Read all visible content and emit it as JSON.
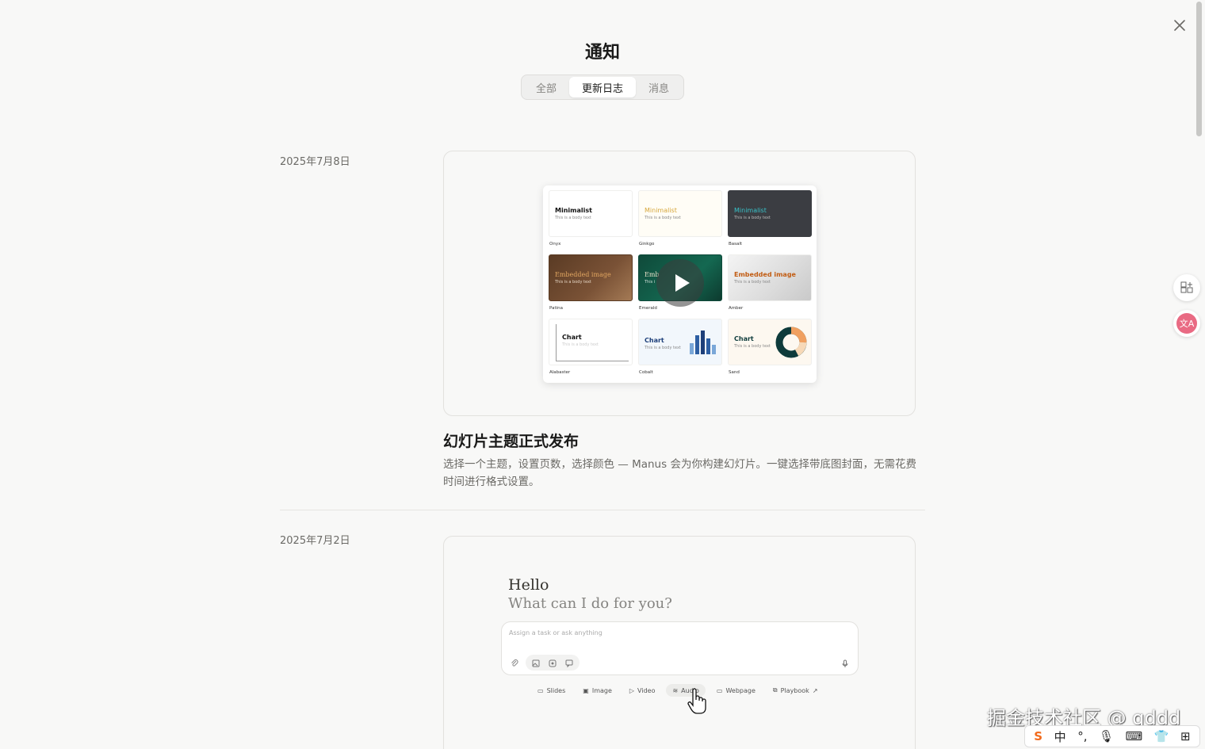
{
  "header": {
    "title": "通知",
    "tabs": [
      {
        "label": "全部",
        "active": false
      },
      {
        "label": "更新日志",
        "active": true
      },
      {
        "label": "消息",
        "active": false
      }
    ]
  },
  "entries": [
    {
      "date": "2025年7月8日",
      "title": "幻灯片主题正式发布",
      "description": "选择一个主题，设置页数，选择颜色 — Manus 会为你构建幻灯片。一键选择带底图封面，无需花费时间进行格式设置。",
      "preview": {
        "themes": [
          {
            "name": "Onyx",
            "heading": "Minimalist",
            "body": "This is a body text"
          },
          {
            "name": "Ginkgo",
            "heading": "Minimalist",
            "body": "This is a body text"
          },
          {
            "name": "Basalt",
            "heading": "Minimalist",
            "body": "This is a body text"
          },
          {
            "name": "Patina",
            "heading": "Embedded image",
            "body": "This is a body text"
          },
          {
            "name": "Emerald",
            "heading": "Emb",
            "body": "This i"
          },
          {
            "name": "Amber",
            "heading": "Embedded image",
            "body": "This is a body text"
          },
          {
            "name": "Alabaster",
            "heading": "Chart",
            "body": "This is a body text"
          },
          {
            "name": "Cobalt",
            "heading": "Chart",
            "body": "This is a body text"
          },
          {
            "name": "Sand",
            "heading": "Chart",
            "body": "This is a body text"
          }
        ]
      }
    },
    {
      "date": "2025年7月2日",
      "preview": {
        "greeting": "Hello",
        "subtitle": "What can I do for you?",
        "input_placeholder": "Assign a task or ask anything",
        "chips": [
          "Slides",
          "Image",
          "Video",
          "Audio",
          "Webpage",
          "Playbook"
        ]
      }
    }
  ],
  "watermark": "掘金技术社区 @ qddd",
  "ime": {
    "mode": "中"
  },
  "colors": {
    "accent_active_tab": "#ffffff",
    "background": "#f8f8f7"
  }
}
